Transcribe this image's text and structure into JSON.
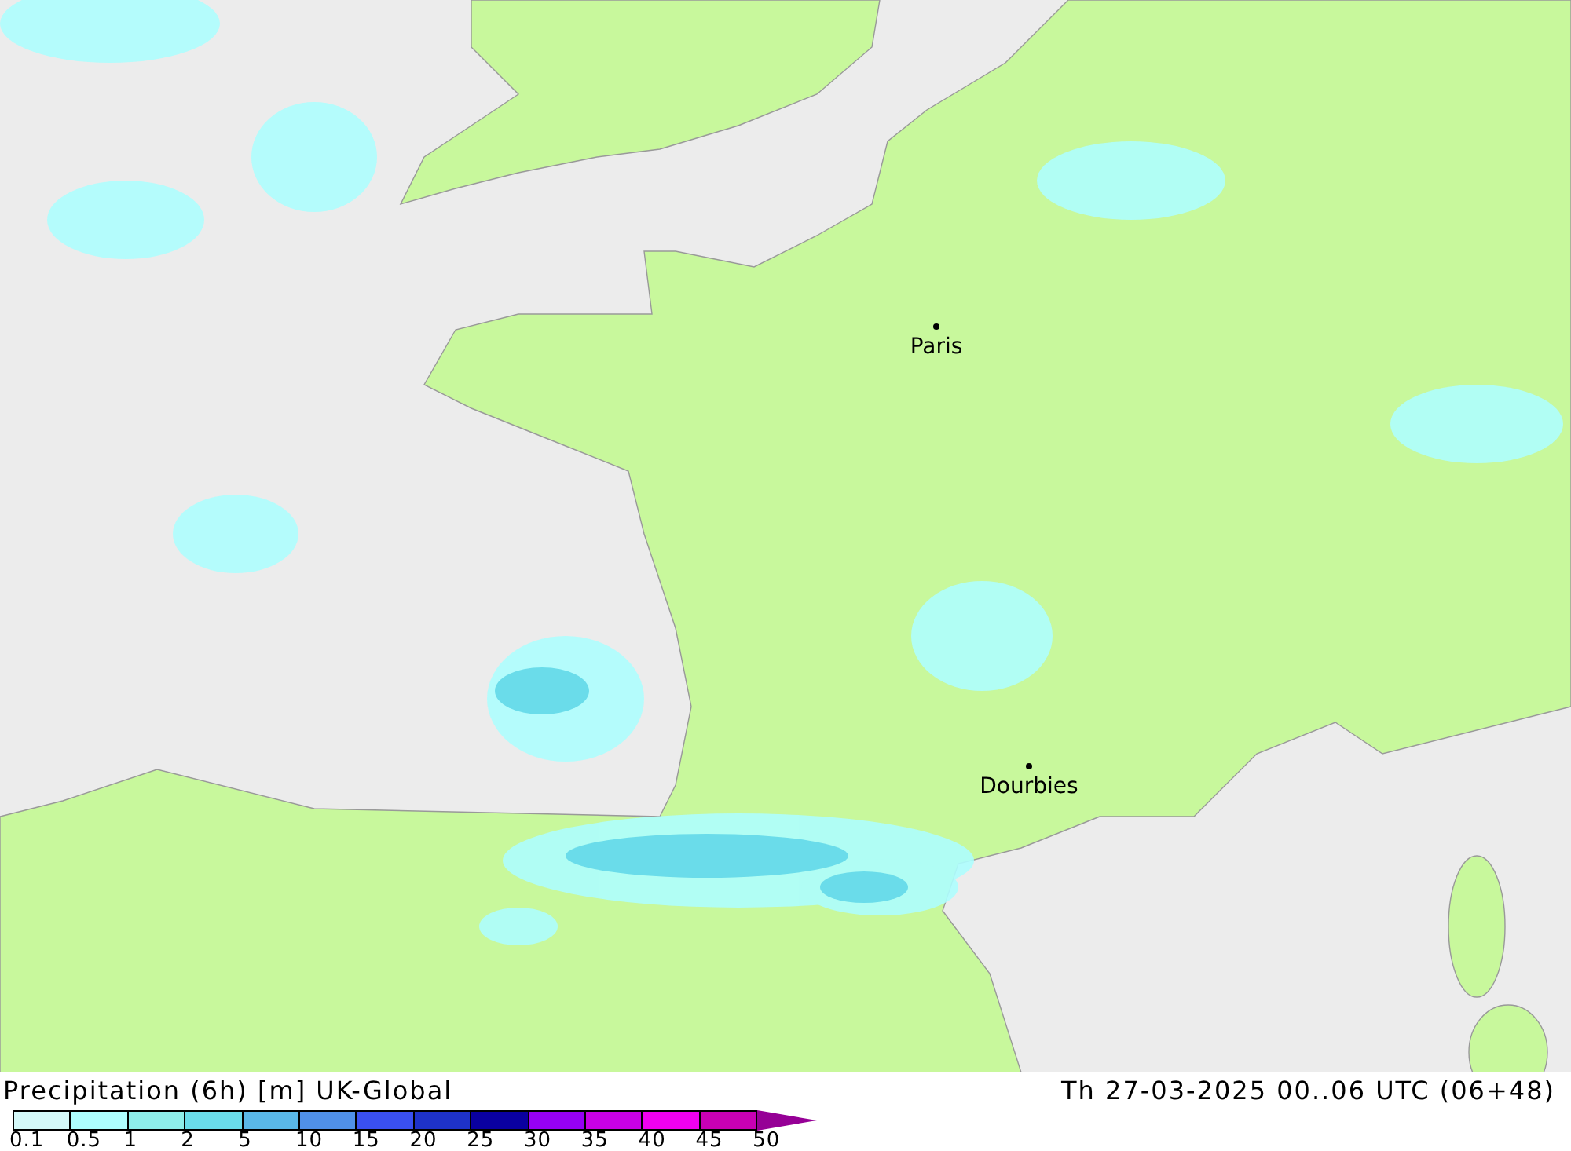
{
  "map": {
    "cities": [
      {
        "name": "Paris"
      },
      {
        "name": "Dourbies"
      }
    ]
  },
  "footer": {
    "title": "Precipitation (6h) [m] UK-Global",
    "valid_time": "Th 27-03-2025 00..06 UTC (06+48)"
  },
  "legend": {
    "swatches": [
      {
        "color": "#d4f8f8"
      },
      {
        "color": "#aefefe"
      },
      {
        "color": "#8eeeea"
      },
      {
        "color": "#6adcea"
      },
      {
        "color": "#5ab8e8"
      },
      {
        "color": "#5090e8"
      },
      {
        "color": "#3a50f0"
      },
      {
        "color": "#1e32c8"
      },
      {
        "color": "#0a00a0"
      },
      {
        "color": "#9600f4"
      },
      {
        "color": "#c800e6"
      },
      {
        "color": "#f000f0"
      },
      {
        "color": "#c800b4"
      }
    ],
    "ticks": [
      "0.1",
      "0.5",
      "1",
      "2",
      "5",
      "10",
      "15",
      "20",
      "25",
      "30",
      "35",
      "40",
      "45",
      "50"
    ]
  }
}
